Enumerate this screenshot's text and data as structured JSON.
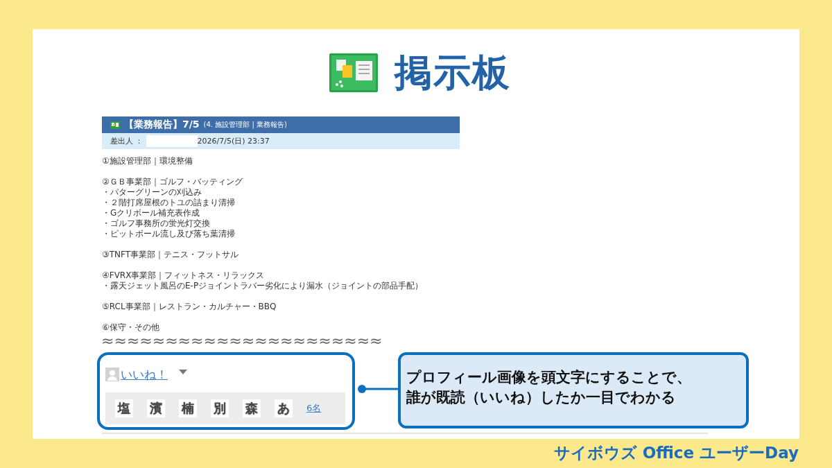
{
  "slide": {
    "title": "掲示板",
    "footer": "サイボウズ Office ユーザーDay"
  },
  "post": {
    "title": "【業務報告】7/5",
    "category": "(4. 施設管理部 | 業務報告)",
    "sender_label": "差出人 ：",
    "date": "2026/7/5(日) 23:37",
    "paragraphs": [
      [
        "①施設管理部｜環境整備"
      ],
      [
        "②ＧＢ事業部｜ゴルフ・バッティング",
        "・パターグリーンの刈込み",
        "・２階打席屋根のトユの詰まり清掃",
        "・Gクリボール補充表作成",
        "・ゴルフ事務所の蛍光灯交換",
        "・ピットボール流し及び落ち葉清掃"
      ],
      [
        "③TNFT事業部｜テニス・フットサル"
      ],
      [
        "④FVRX事業部｜フィットネス・リラックス",
        "・露天ジェット風呂のE-Pジョイントラバー劣化により漏水（ジョイントの部品手配）"
      ],
      [
        "⑤RCL事業部｜レストラン・カルチャー・BBQ"
      ],
      [
        "⑥保守・その他"
      ]
    ],
    "cut_mark": "≈≈≈≈≈≈≈≈≈≈≈≈≈≈≈≈≈≈≈≈≈≈"
  },
  "likes": {
    "label": "いいね！",
    "readers": [
      "塩",
      "濱",
      "楠",
      "別",
      "森",
      "あ"
    ],
    "count": "6名"
  },
  "callout": {
    "lines": [
      "プロフィール画像を頭文字にすることで、",
      "誰が既読（いいね）したか一目でわかる"
    ]
  }
}
